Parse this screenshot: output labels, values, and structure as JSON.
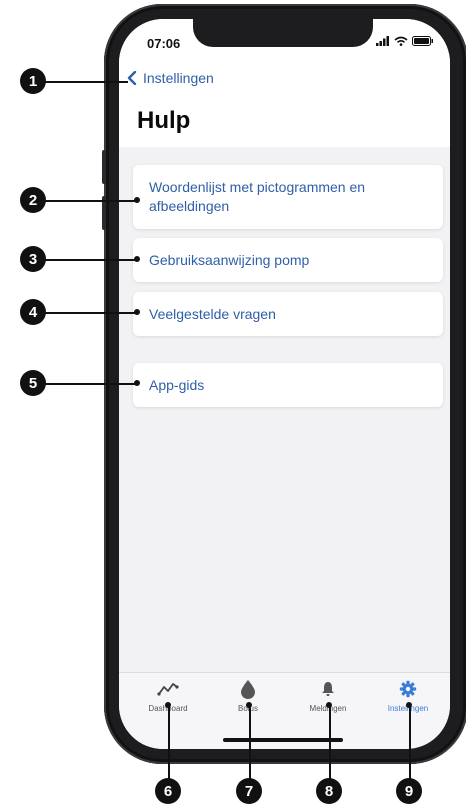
{
  "status_bar": {
    "time": "07:06"
  },
  "header": {
    "back_label": "Instellingen",
    "title": "Hulp"
  },
  "menu": {
    "items": [
      {
        "label": "Woordenlijst met pictogrammen en afbeeldingen"
      },
      {
        "label": "Gebruiksaanwijzing pomp"
      },
      {
        "label": "Veelgestelde vragen"
      },
      {
        "label": "App-gids"
      }
    ]
  },
  "tab_bar": {
    "tabs": [
      {
        "label": "Dashboard",
        "icon": "trend-icon"
      },
      {
        "label": "Bolus",
        "icon": "drop-icon"
      },
      {
        "label": "Meldingen",
        "icon": "bell-icon"
      },
      {
        "label": "Instellingen",
        "icon": "gear-icon",
        "active": true
      }
    ]
  },
  "callouts": [
    "1",
    "2",
    "3",
    "4",
    "5",
    "6",
    "7",
    "8",
    "9"
  ],
  "colors": {
    "link": "#2f5fa8",
    "active_tab": "#3a7bd5",
    "background": "#f2f2f4"
  }
}
